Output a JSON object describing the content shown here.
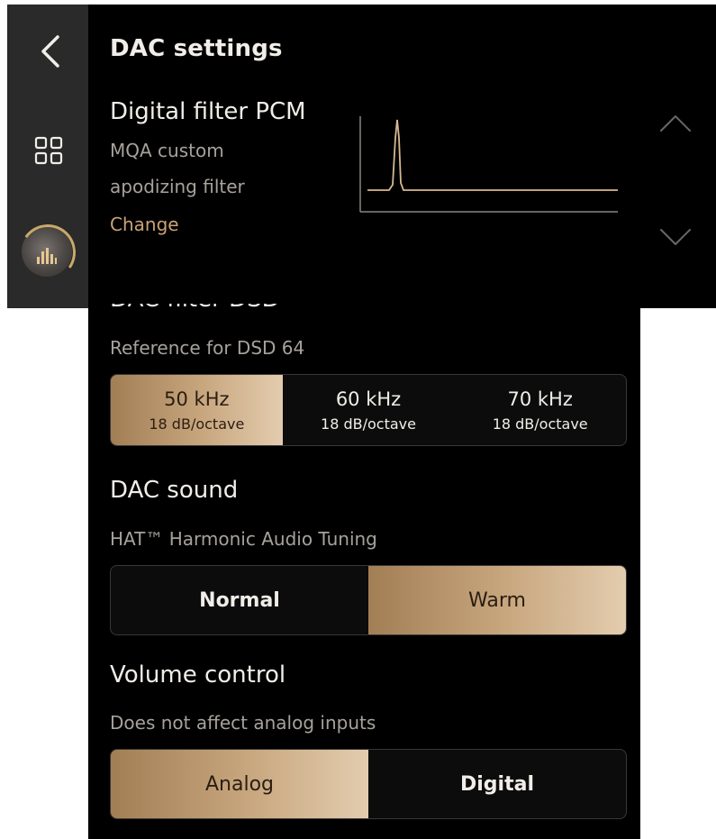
{
  "header": {
    "title": "DAC settings"
  },
  "pcm": {
    "title": "Digital filter PCM",
    "filter_line1": "MQA custom",
    "filter_line2": "apodizing filter",
    "change_label": "Change"
  },
  "dsd": {
    "title": "DAC filter DSD",
    "subtitle": "Reference for DSD 64",
    "options": [
      {
        "freq": "50 kHz",
        "slope": "18 dB/octave",
        "selected": true
      },
      {
        "freq": "60 kHz",
        "slope": "18 dB/octave",
        "selected": false
      },
      {
        "freq": "70 kHz",
        "slope": "18 dB/octave",
        "selected": false
      }
    ]
  },
  "sound": {
    "title": "DAC sound",
    "subtitle": "HAT™ Harmonic Audio Tuning",
    "options": [
      {
        "label": "Normal",
        "selected": false
      },
      {
        "label": "Warm",
        "selected": true
      }
    ]
  },
  "volume": {
    "title": "Volume control",
    "subtitle": "Does not affect analog inputs",
    "options": [
      {
        "label": "Analog",
        "selected": true
      },
      {
        "label": "Digital",
        "selected": false
      }
    ]
  },
  "icons": {
    "back": "chevron-left-icon",
    "grid": "grid-icon",
    "player": "now-playing-icon",
    "up": "chevron-up-icon",
    "down": "chevron-down-icon"
  },
  "colors": {
    "accent_gold": "#c9a277",
    "graph_line": "#d6b98e",
    "background": "#000000",
    "sidebar": "#2a2a2a"
  }
}
